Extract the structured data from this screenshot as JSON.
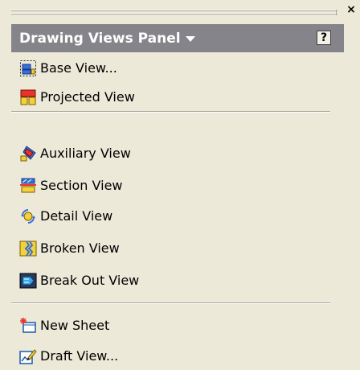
{
  "panel": {
    "title": "Drawing Views Panel",
    "help_label": "?",
    "close_label": "×"
  },
  "items": [
    {
      "label": "Base View...",
      "icon": "base-view-icon"
    },
    {
      "label": "Projected View",
      "icon": "projected-view-icon"
    },
    {
      "label": "Auxiliary View",
      "icon": "auxiliary-view-icon"
    },
    {
      "label": "Section View",
      "icon": "section-view-icon"
    },
    {
      "label": "Detail View",
      "icon": "detail-view-icon"
    },
    {
      "label": "Broken View",
      "icon": "broken-view-icon"
    },
    {
      "label": "Break Out View",
      "icon": "break-out-view-icon"
    },
    {
      "label": "New Sheet",
      "icon": "new-sheet-icon"
    },
    {
      "label": "Draft View...",
      "icon": "draft-view-icon"
    }
  ],
  "colors": {
    "background": "#ece9d8",
    "header": "#84848a",
    "header_text": "#ffffff"
  }
}
